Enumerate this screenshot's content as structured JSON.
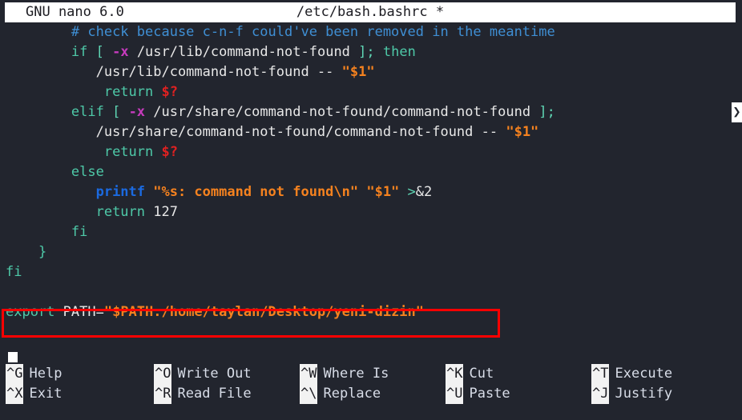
{
  "titlebar": {
    "program": "GNU nano 6.0",
    "filename": "/etc/bash.bashrc *"
  },
  "editor": {
    "lines": [
      {
        "indent": "        ",
        "tokens": [
          {
            "text": "# check because c-n-f could've been removed in the meantime",
            "cls": "t-comment"
          }
        ],
        "continued": false
      },
      {
        "indent": "        ",
        "tokens": [
          {
            "text": "if ",
            "cls": "t-kw"
          },
          {
            "text": "[ ",
            "cls": "t-brk"
          },
          {
            "text": "-x",
            "cls": "t-flag"
          },
          {
            "text": " /usr/lib/command-not-found ",
            "cls": "t-plain"
          },
          {
            "text": "]; ",
            "cls": "t-brk"
          },
          {
            "text": "then",
            "cls": "t-kw"
          }
        ],
        "continued": false
      },
      {
        "indent": "           ",
        "tokens": [
          {
            "text": "/usr/lib/command-not-found -- ",
            "cls": "t-plain"
          },
          {
            "text": "\"$1\"",
            "cls": "t-str"
          }
        ],
        "continued": false
      },
      {
        "indent": "            ",
        "tokens": [
          {
            "text": "return ",
            "cls": "t-kw"
          },
          {
            "text": "$?",
            "cls": "t-err"
          }
        ],
        "continued": false
      },
      {
        "indent": "        ",
        "tokens": [
          {
            "text": "elif ",
            "cls": "t-kw"
          },
          {
            "text": "[ ",
            "cls": "t-brk"
          },
          {
            "text": "-x",
            "cls": "t-flag"
          },
          {
            "text": " /usr/share/command-not-found/command-not-found ",
            "cls": "t-plain"
          },
          {
            "text": "];",
            "cls": "t-brk"
          }
        ],
        "continued": true,
        "continuation_glyph": "❯"
      },
      {
        "indent": "           ",
        "tokens": [
          {
            "text": "/usr/share/command-not-found/command-not-found -- ",
            "cls": "t-plain"
          },
          {
            "text": "\"$1\"",
            "cls": "t-str"
          }
        ],
        "continued": false
      },
      {
        "indent": "            ",
        "tokens": [
          {
            "text": "return ",
            "cls": "t-kw"
          },
          {
            "text": "$?",
            "cls": "t-err"
          }
        ],
        "continued": false
      },
      {
        "indent": "        ",
        "tokens": [
          {
            "text": "else",
            "cls": "t-kw"
          }
        ],
        "continued": false
      },
      {
        "indent": "           ",
        "tokens": [
          {
            "text": "printf ",
            "cls": "t-fn"
          },
          {
            "text": "\"%s: command not found\\n\" \"$1\" ",
            "cls": "t-str"
          },
          {
            "text": ">",
            "cls": "t-redir"
          },
          {
            "text": "&2",
            "cls": "t-plain"
          }
        ],
        "continued": false
      },
      {
        "indent": "           ",
        "tokens": [
          {
            "text": "return ",
            "cls": "t-kw"
          },
          {
            "text": "127",
            "cls": "t-num"
          }
        ],
        "continued": false
      },
      {
        "indent": "        ",
        "tokens": [
          {
            "text": "fi",
            "cls": "t-kw"
          }
        ],
        "continued": false
      },
      {
        "indent": "    ",
        "tokens": [
          {
            "text": "}",
            "cls": "t-kw"
          }
        ],
        "continued": false
      },
      {
        "indent": "",
        "tokens": [
          {
            "text": "fi",
            "cls": "t-kw"
          }
        ],
        "continued": false
      },
      {
        "indent": "",
        "tokens": [],
        "continued": false
      },
      {
        "indent": "",
        "tokens": [
          {
            "text": "export ",
            "cls": "t-kw"
          },
          {
            "text": "PATH=",
            "cls": "t-plain"
          },
          {
            "text": "\"$PATH:/home/taylan/Desktop/yeni-dizin\"",
            "cls": "t-str"
          }
        ],
        "continued": false
      },
      {
        "indent": "",
        "tokens": [],
        "continued": false
      },
      {
        "indent": "",
        "tokens": [],
        "continued": false
      }
    ],
    "annotation": {
      "color": "#fe0000",
      "target_text": "export PATH=\"$PATH:/home/taylan/Desktop/yeni-dizin\""
    },
    "cursor": {
      "color": "#ffffff"
    }
  },
  "footer": {
    "rows": [
      [
        {
          "key": "^G",
          "label": "Help"
        },
        {
          "key": "^O",
          "label": "Write Out"
        },
        {
          "key": "^W",
          "label": "Where Is"
        },
        {
          "key": "^K",
          "label": "Cut"
        },
        {
          "key": "^T",
          "label": "Execute"
        }
      ],
      [
        {
          "key": "^X",
          "label": "Exit"
        },
        {
          "key": "^R",
          "label": "Read File"
        },
        {
          "key": "^\\",
          "label": "Replace"
        },
        {
          "key": "^U",
          "label": "Paste"
        },
        {
          "key": "^J",
          "label": "Justify"
        }
      ]
    ]
  },
  "theme": {
    "background": "#22252e",
    "foreground": "#e8e8e8",
    "titlebar_bg": "#ffffff",
    "titlebar_fg": "#1c1c22",
    "annotation": "#fe0000"
  }
}
